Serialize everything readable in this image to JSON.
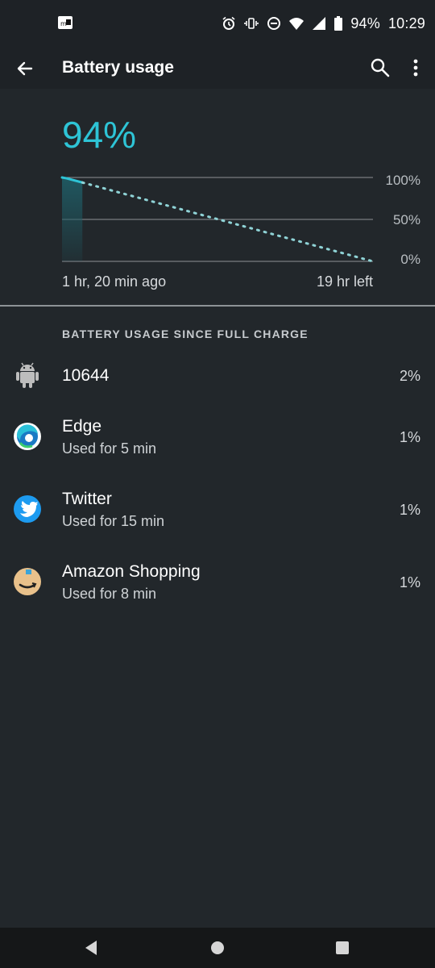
{
  "status_bar": {
    "battery_text": "94%",
    "time": "10:29",
    "icons": [
      "carrier-badge-icon",
      "alarm-icon",
      "vibrate-icon",
      "do-not-disturb-icon",
      "wifi-icon",
      "signal-icon",
      "battery-icon"
    ]
  },
  "app_bar": {
    "title": "Battery usage",
    "icons": [
      "back-arrow-icon",
      "search-icon",
      "more-vert-icon"
    ]
  },
  "summary": {
    "percent": "94%",
    "time_since": "1 hr, 20 min ago",
    "time_left": "19 hr left"
  },
  "chart_data": {
    "type": "line",
    "y_ticks": [
      "100%",
      "50%",
      "0%"
    ],
    "ylim": [
      0,
      100
    ],
    "measured": {
      "name": "",
      "x_hours": [
        0,
        0.3,
        1.33
      ],
      "y": [
        100,
        99,
        94
      ]
    },
    "projection": {
      "name": "",
      "x_hours": [
        1.33,
        20.33
      ],
      "y": [
        94,
        0
      ],
      "style": "dotted"
    },
    "xlabel_left": "1 hr, 20 min ago",
    "xlabel_right": "19 hr left",
    "colors": {
      "line": "#2ec4d6",
      "projection": "#8fd3d6",
      "fill": "#1f5a63",
      "grid": "#8d9296"
    }
  },
  "section_title": "BATTERY USAGE SINCE FULL CHARGE",
  "apps": [
    {
      "name": "10644",
      "subtitle": "",
      "percent": "2%",
      "icon": "android-icon"
    },
    {
      "name": "Edge",
      "subtitle": "Used for 5 min",
      "percent": "1%",
      "icon": "edge-icon"
    },
    {
      "name": "Twitter",
      "subtitle": "Used for 15 min",
      "percent": "1%",
      "icon": "twitter-icon"
    },
    {
      "name": "Amazon Shopping",
      "subtitle": "Used for 8 min",
      "percent": "1%",
      "icon": "amazon-icon"
    }
  ],
  "nav_bar": {
    "icons": [
      "back-triangle-icon",
      "home-circle-icon",
      "recents-square-icon"
    ]
  }
}
